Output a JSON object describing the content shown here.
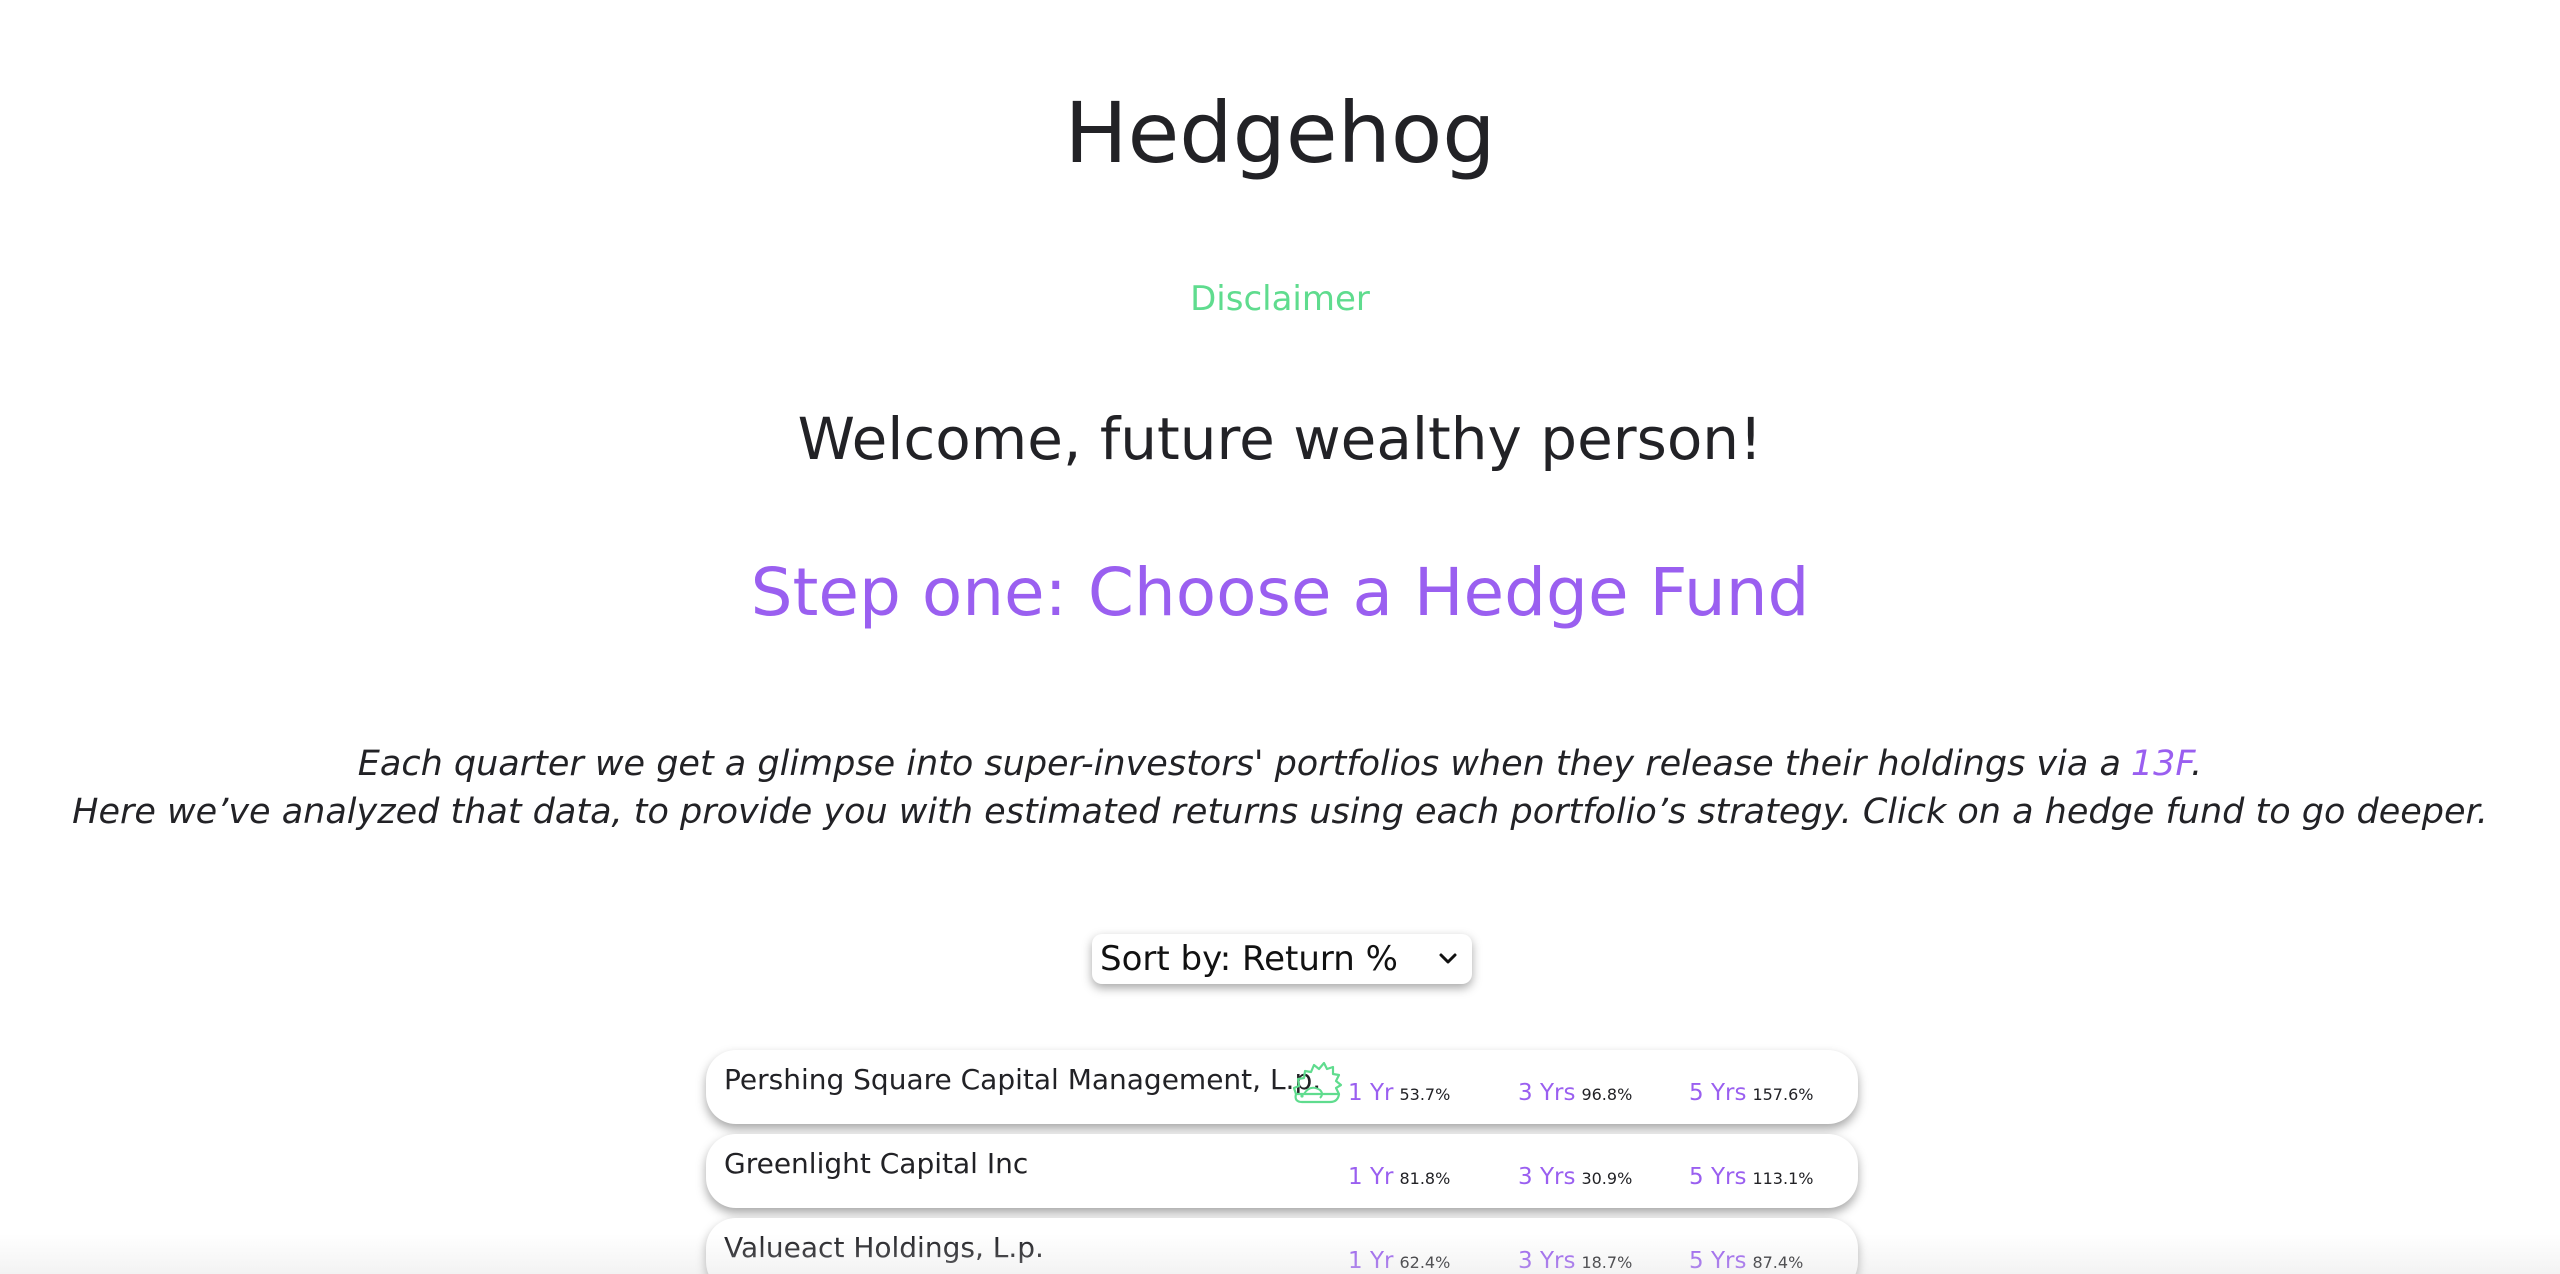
{
  "header": {
    "title": "Hedgehog",
    "disclaimer_label": "Disclaimer"
  },
  "main": {
    "welcome": "Welcome, future wealthy person!",
    "step_title": "Step one: Choose a Hedge Fund",
    "intro_line1": "Each quarter we get a glimpse into super-investors' portfolios when they release their holdings via a",
    "intro_link": "13F",
    "intro_line1_end": ".",
    "intro_line2": "Here we’ve analyzed that data, to provide you with estimated returns using each portfolio’s strategy. Click on a hedge fund to go deeper."
  },
  "sort": {
    "selected": "Sort by: Return %"
  },
  "colors": {
    "accent_purple": "#9a5ff0",
    "accent_green": "#5fdc8e",
    "text_dark": "#222226"
  },
  "funds": [
    {
      "name": "Pershing Square Capital Management, L.p.",
      "featured_icon": "hedgehog-icon",
      "one_yr_label": "1 Yr",
      "one_yr": "53.7%",
      "three_yr_label": "3 Yrs",
      "three_yr": "96.8%",
      "five_yr_label": "5 Yrs",
      "five_yr": "157.6%"
    },
    {
      "name": "Greenlight Capital Inc",
      "one_yr_label": "1 Yr",
      "one_yr": "81.8%",
      "three_yr_label": "3 Yrs",
      "three_yr": "30.9%",
      "five_yr_label": "5 Yrs",
      "five_yr": "113.1%"
    },
    {
      "name": "Valueact Holdings, L.p.",
      "one_yr_label": "1 Yr",
      "one_yr": "62.4%",
      "three_yr_label": "3 Yrs",
      "three_yr": "18.7%",
      "five_yr_label": "5 Yrs",
      "five_yr": "87.4%"
    }
  ]
}
